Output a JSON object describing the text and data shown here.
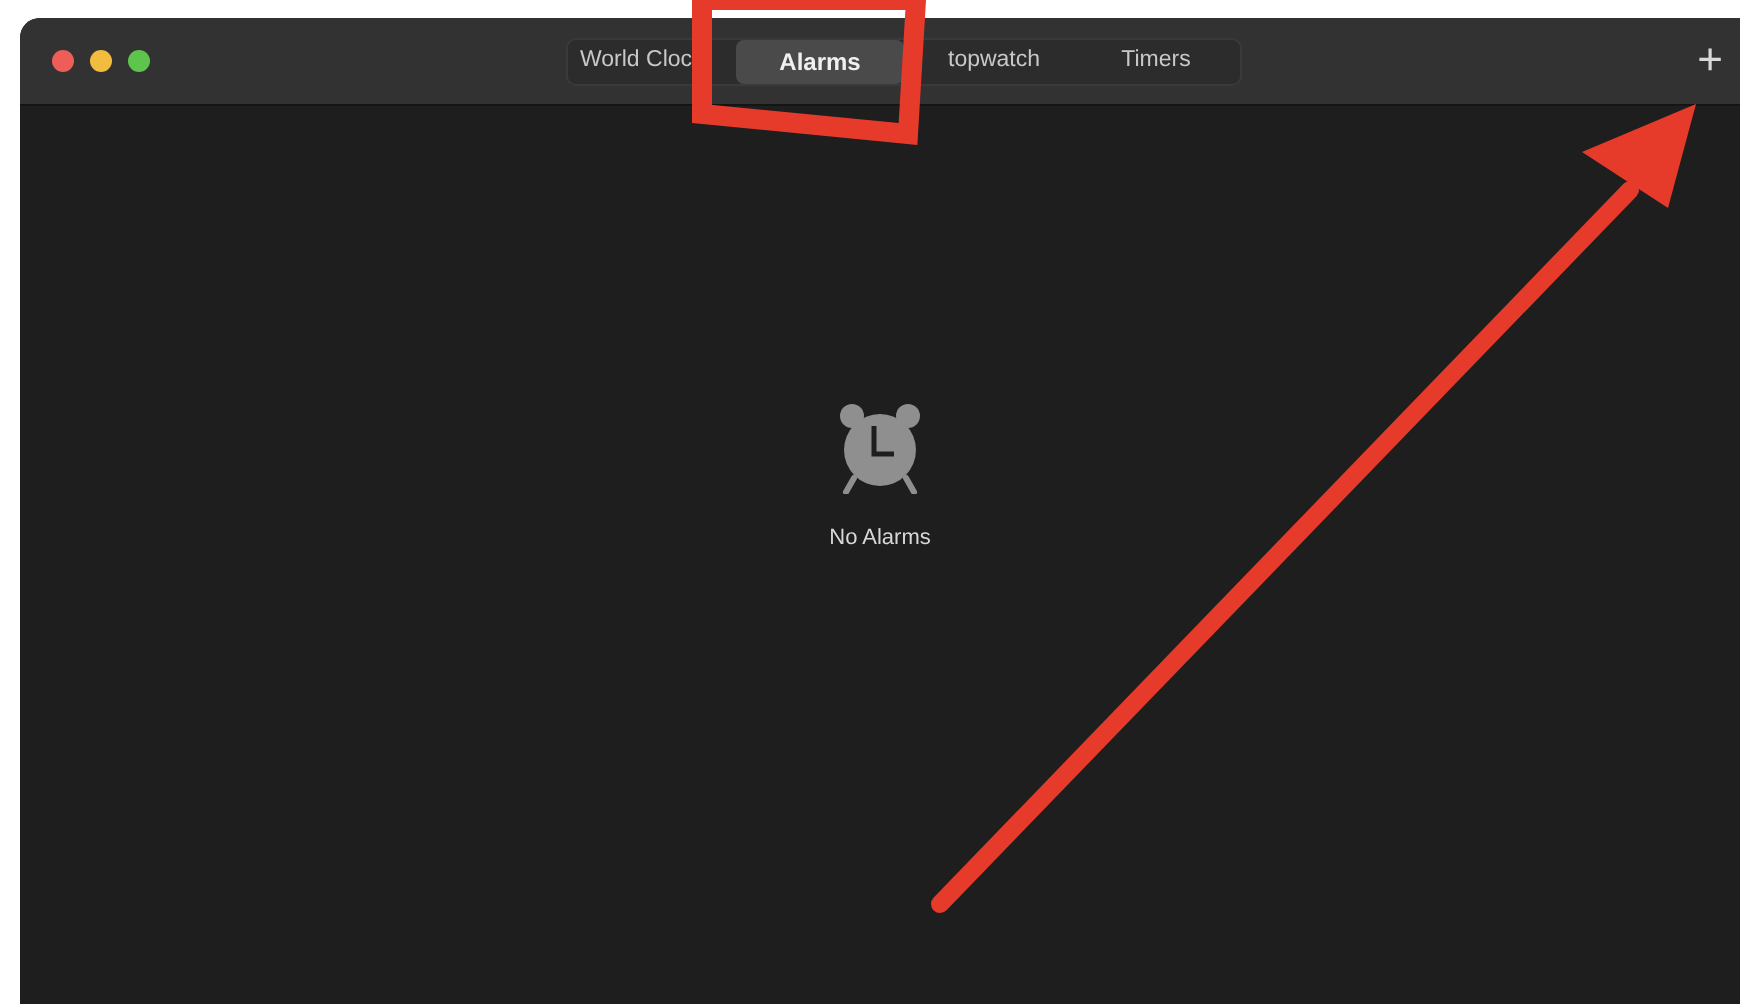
{
  "tabs": [
    {
      "label": "World Cloc",
      "selected": false
    },
    {
      "label": "Alarms",
      "selected": true
    },
    {
      "label": "topwatch",
      "selected": false
    },
    {
      "label": "Timers",
      "selected": false
    }
  ],
  "add_button": "+",
  "empty_state": {
    "message": "No Alarms"
  }
}
